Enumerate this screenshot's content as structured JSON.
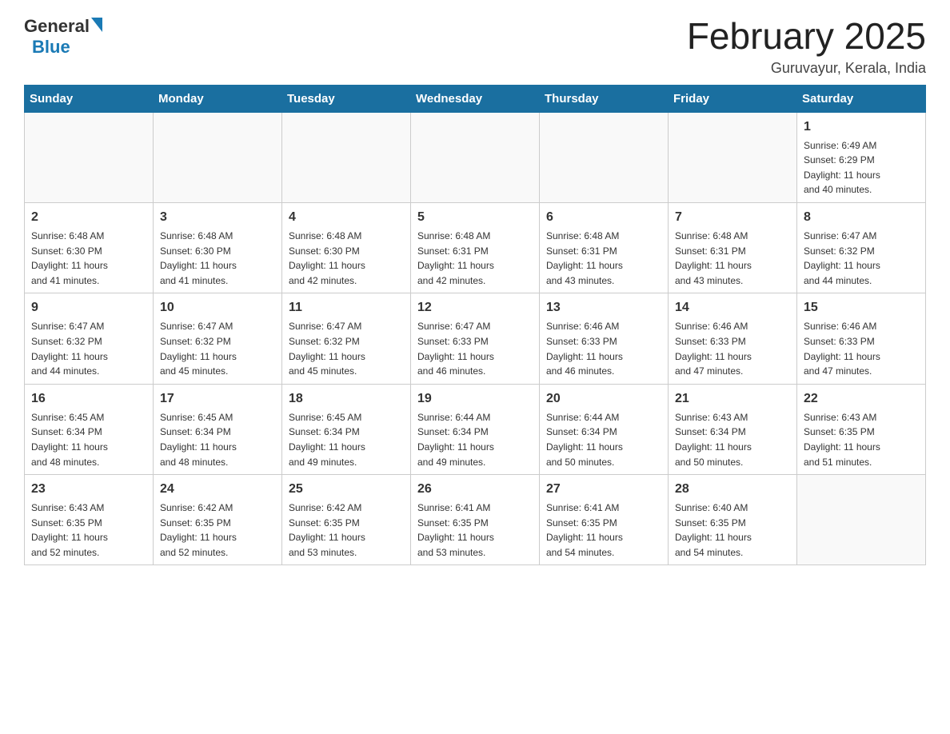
{
  "header": {
    "logo": {
      "general": "General",
      "blue": "Blue"
    },
    "title": "February 2025",
    "location": "Guruvayur, Kerala, India"
  },
  "weekdays": [
    "Sunday",
    "Monday",
    "Tuesday",
    "Wednesday",
    "Thursday",
    "Friday",
    "Saturday"
  ],
  "weeks": [
    [
      {
        "day": "",
        "info": ""
      },
      {
        "day": "",
        "info": ""
      },
      {
        "day": "",
        "info": ""
      },
      {
        "day": "",
        "info": ""
      },
      {
        "day": "",
        "info": ""
      },
      {
        "day": "",
        "info": ""
      },
      {
        "day": "1",
        "info": "Sunrise: 6:49 AM\nSunset: 6:29 PM\nDaylight: 11 hours\nand 40 minutes."
      }
    ],
    [
      {
        "day": "2",
        "info": "Sunrise: 6:48 AM\nSunset: 6:30 PM\nDaylight: 11 hours\nand 41 minutes."
      },
      {
        "day": "3",
        "info": "Sunrise: 6:48 AM\nSunset: 6:30 PM\nDaylight: 11 hours\nand 41 minutes."
      },
      {
        "day": "4",
        "info": "Sunrise: 6:48 AM\nSunset: 6:30 PM\nDaylight: 11 hours\nand 42 minutes."
      },
      {
        "day": "5",
        "info": "Sunrise: 6:48 AM\nSunset: 6:31 PM\nDaylight: 11 hours\nand 42 minutes."
      },
      {
        "day": "6",
        "info": "Sunrise: 6:48 AM\nSunset: 6:31 PM\nDaylight: 11 hours\nand 43 minutes."
      },
      {
        "day": "7",
        "info": "Sunrise: 6:48 AM\nSunset: 6:31 PM\nDaylight: 11 hours\nand 43 minutes."
      },
      {
        "day": "8",
        "info": "Sunrise: 6:47 AM\nSunset: 6:32 PM\nDaylight: 11 hours\nand 44 minutes."
      }
    ],
    [
      {
        "day": "9",
        "info": "Sunrise: 6:47 AM\nSunset: 6:32 PM\nDaylight: 11 hours\nand 44 minutes."
      },
      {
        "day": "10",
        "info": "Sunrise: 6:47 AM\nSunset: 6:32 PM\nDaylight: 11 hours\nand 45 minutes."
      },
      {
        "day": "11",
        "info": "Sunrise: 6:47 AM\nSunset: 6:32 PM\nDaylight: 11 hours\nand 45 minutes."
      },
      {
        "day": "12",
        "info": "Sunrise: 6:47 AM\nSunset: 6:33 PM\nDaylight: 11 hours\nand 46 minutes."
      },
      {
        "day": "13",
        "info": "Sunrise: 6:46 AM\nSunset: 6:33 PM\nDaylight: 11 hours\nand 46 minutes."
      },
      {
        "day": "14",
        "info": "Sunrise: 6:46 AM\nSunset: 6:33 PM\nDaylight: 11 hours\nand 47 minutes."
      },
      {
        "day": "15",
        "info": "Sunrise: 6:46 AM\nSunset: 6:33 PM\nDaylight: 11 hours\nand 47 minutes."
      }
    ],
    [
      {
        "day": "16",
        "info": "Sunrise: 6:45 AM\nSunset: 6:34 PM\nDaylight: 11 hours\nand 48 minutes."
      },
      {
        "day": "17",
        "info": "Sunrise: 6:45 AM\nSunset: 6:34 PM\nDaylight: 11 hours\nand 48 minutes."
      },
      {
        "day": "18",
        "info": "Sunrise: 6:45 AM\nSunset: 6:34 PM\nDaylight: 11 hours\nand 49 minutes."
      },
      {
        "day": "19",
        "info": "Sunrise: 6:44 AM\nSunset: 6:34 PM\nDaylight: 11 hours\nand 49 minutes."
      },
      {
        "day": "20",
        "info": "Sunrise: 6:44 AM\nSunset: 6:34 PM\nDaylight: 11 hours\nand 50 minutes."
      },
      {
        "day": "21",
        "info": "Sunrise: 6:43 AM\nSunset: 6:34 PM\nDaylight: 11 hours\nand 50 minutes."
      },
      {
        "day": "22",
        "info": "Sunrise: 6:43 AM\nSunset: 6:35 PM\nDaylight: 11 hours\nand 51 minutes."
      }
    ],
    [
      {
        "day": "23",
        "info": "Sunrise: 6:43 AM\nSunset: 6:35 PM\nDaylight: 11 hours\nand 52 minutes."
      },
      {
        "day": "24",
        "info": "Sunrise: 6:42 AM\nSunset: 6:35 PM\nDaylight: 11 hours\nand 52 minutes."
      },
      {
        "day": "25",
        "info": "Sunrise: 6:42 AM\nSunset: 6:35 PM\nDaylight: 11 hours\nand 53 minutes."
      },
      {
        "day": "26",
        "info": "Sunrise: 6:41 AM\nSunset: 6:35 PM\nDaylight: 11 hours\nand 53 minutes."
      },
      {
        "day": "27",
        "info": "Sunrise: 6:41 AM\nSunset: 6:35 PM\nDaylight: 11 hours\nand 54 minutes."
      },
      {
        "day": "28",
        "info": "Sunrise: 6:40 AM\nSunset: 6:35 PM\nDaylight: 11 hours\nand 54 minutes."
      },
      {
        "day": "",
        "info": ""
      }
    ]
  ]
}
